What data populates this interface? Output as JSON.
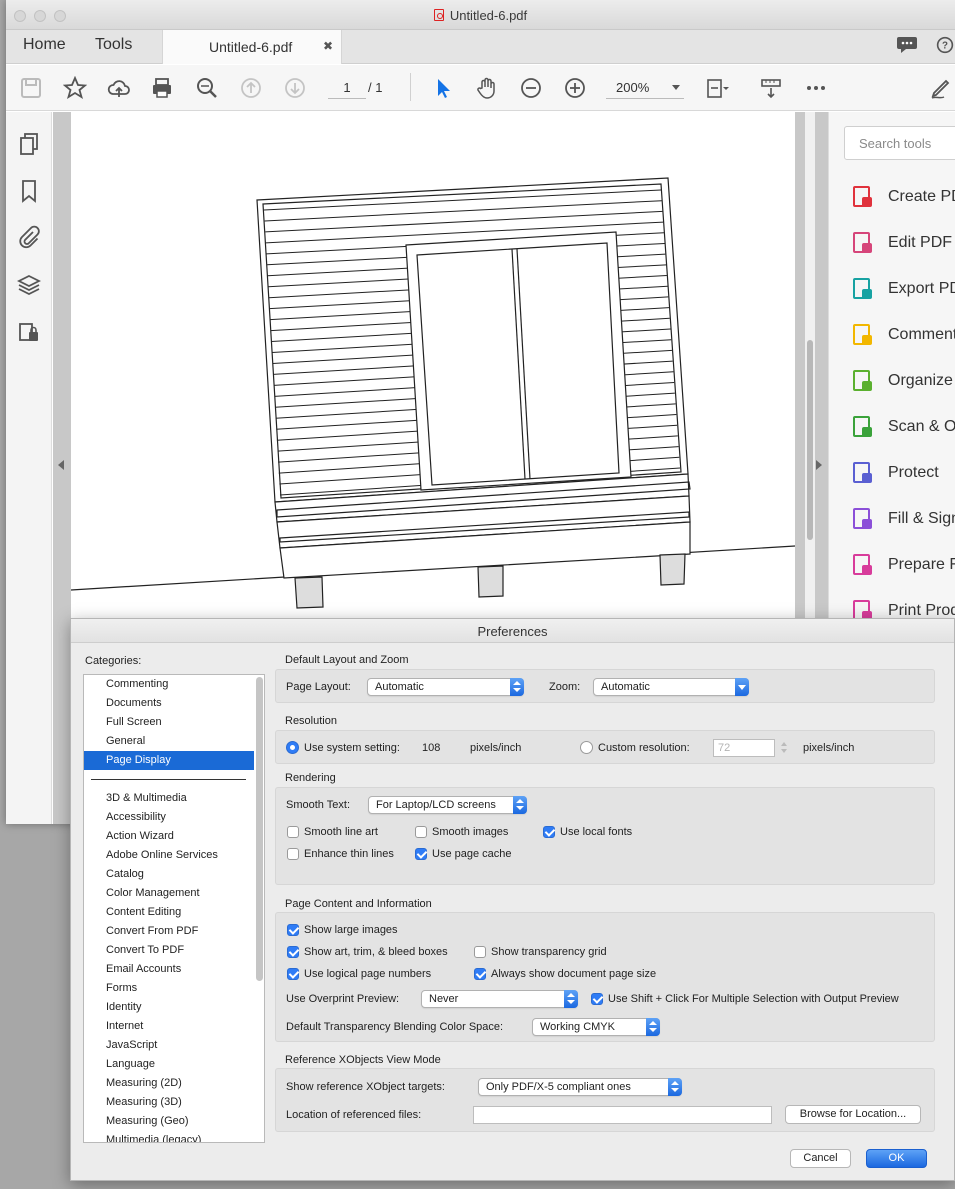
{
  "window": {
    "title": "Untitled-6.pdf"
  },
  "tabs": {
    "home": "Home",
    "tools": "Tools",
    "document": "Untitled-6.pdf",
    "close": "✖"
  },
  "toolbar": {
    "page_current": "1",
    "page_total": "/ 1",
    "zoom": "200%"
  },
  "right_pane": {
    "search_placeholder": "Search tools",
    "items": [
      {
        "label": "Create PD",
        "icon": "create-pdf-icon",
        "color": "#e0323c"
      },
      {
        "label": "Edit PDF",
        "icon": "edit-pdf-icon",
        "color": "#d6457a"
      },
      {
        "label": "Export PD",
        "icon": "export-pdf-icon",
        "color": "#17a2a2"
      },
      {
        "label": "Comment",
        "icon": "comment-icon",
        "color": "#f2b700"
      },
      {
        "label": "Organize P",
        "icon": "organize-pages-icon",
        "color": "#5bb02f"
      },
      {
        "label": "Scan & OC",
        "icon": "scan-ocr-icon",
        "color": "#3aa23a"
      },
      {
        "label": "Protect",
        "icon": "protect-icon",
        "color": "#5a5fd2"
      },
      {
        "label": "Fill & Sign",
        "icon": "fill-sign-icon",
        "color": "#8b4fd8"
      },
      {
        "label": "Prepare Fo",
        "icon": "prepare-form-icon",
        "color": "#d83c9b"
      },
      {
        "label": "Print Prod",
        "icon": "print-production-icon",
        "color": "#d83c9b"
      }
    ]
  },
  "dialog": {
    "title": "Preferences",
    "categories_label": "Categories:",
    "categories_top": [
      "Commenting",
      "Documents",
      "Full Screen",
      "General",
      "Page Display"
    ],
    "categories": [
      "3D & Multimedia",
      "Accessibility",
      "Action Wizard",
      "Adobe Online Services",
      "Catalog",
      "Color Management",
      "Content Editing",
      "Convert From PDF",
      "Convert To PDF",
      "Email Accounts",
      "Forms",
      "Identity",
      "Internet",
      "JavaScript",
      "Language",
      "Measuring (2D)",
      "Measuring (3D)",
      "Measuring (Geo)",
      "Multimedia (legacy)"
    ],
    "selected_category": "Page Display",
    "layout_zoom": {
      "title": "Default Layout and Zoom",
      "page_layout_label": "Page Layout:",
      "page_layout_value": "Automatic",
      "zoom_label": "Zoom:",
      "zoom_value": "Automatic"
    },
    "resolution": {
      "title": "Resolution",
      "system_label": "Use system setting:",
      "system_value": "108",
      "system_unit": "pixels/inch",
      "custom_label": "Custom resolution:",
      "custom_value": "72",
      "custom_unit": "pixels/inch"
    },
    "rendering": {
      "title": "Rendering",
      "smooth_text_label": "Smooth Text:",
      "smooth_text_value": "For Laptop/LCD screens",
      "smooth_line_art": "Smooth line art",
      "smooth_images": "Smooth images",
      "use_local_fonts": "Use local fonts",
      "enhance_thin_lines": "Enhance thin lines",
      "use_page_cache": "Use page cache"
    },
    "content": {
      "title": "Page Content and Information",
      "show_large_images": "Show large images",
      "show_art_trim": "Show art, trim, & bleed boxes",
      "show_transparency_grid": "Show transparency grid",
      "use_logical_page_numbers": "Use logical page numbers",
      "always_show_page_size": "Always show document page size",
      "overprint_label": "Use Overprint Preview:",
      "overprint_value": "Never",
      "shift_click": "Use Shift + Click For Multiple Selection with Output Preview",
      "blending_label": "Default Transparency Blending Color Space:",
      "blending_value": "Working CMYK"
    },
    "xobjects": {
      "title": "Reference XObjects View Mode",
      "targets_label": "Show reference XObject targets:",
      "targets_value": "Only PDF/X-5 compliant ones",
      "location_label": "Location of referenced files:",
      "location_value": "",
      "browse_button": "Browse for Location..."
    },
    "cancel_button": "Cancel",
    "ok_button": "OK"
  }
}
